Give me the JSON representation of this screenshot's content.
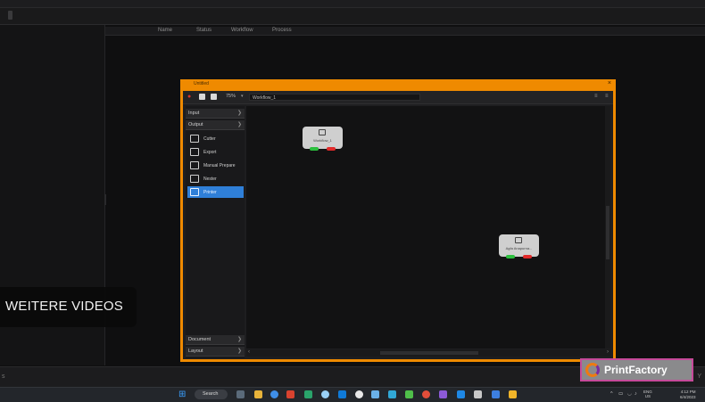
{
  "app": {
    "columns": [
      "Name",
      "Status",
      "Workflow",
      "Process"
    ],
    "status_left": "s",
    "status_right": "Y"
  },
  "dialog": {
    "title": "Untitled",
    "close": "×",
    "zoom": "75%",
    "zoom_arrow": "▾",
    "workflow_name": "Workflow_1",
    "toolbar_right": [
      "≡",
      "≡"
    ]
  },
  "sidebar": {
    "sections_top": [
      {
        "label": "Input",
        "chevron": "❯"
      },
      {
        "label": "Output",
        "chevron": "❯"
      }
    ],
    "items": [
      {
        "label": "Cutter",
        "icon": "cutter-icon"
      },
      {
        "label": "Export",
        "icon": "export-icon"
      },
      {
        "label": "Manual Prepare",
        "icon": "manual-prepare-icon"
      },
      {
        "label": "Nester",
        "icon": "nester-icon"
      },
      {
        "label": "Printer",
        "icon": "printer-icon",
        "selected": true
      }
    ],
    "sections_bottom": [
      {
        "label": "Document",
        "chevron": "❯"
      },
      {
        "label": "Layout",
        "chevron": "❯"
      }
    ]
  },
  "nodes": [
    {
      "label": "Workflow_1",
      "icon": "window-icon"
    },
    {
      "label": "Agfa Anapurna...",
      "icon": "printer-icon"
    }
  ],
  "overlay": {
    "more_videos": "WEITERE VIDEOS",
    "brand": "PrintFactory"
  },
  "taskbar": {
    "start_glyph": "⊞",
    "search": "Search",
    "tray_glyphs": [
      "^",
      "▭",
      "◡",
      "♪"
    ],
    "language_line1": "ENG",
    "language_line2": "US",
    "time": "4:12 PM",
    "date": "6/4/2023"
  },
  "colors": {
    "dialog_frame": "#ef8a00",
    "selection": "#2f7fd8",
    "port_ok": "#2cbf3e",
    "port_error": "#e02a2a"
  }
}
